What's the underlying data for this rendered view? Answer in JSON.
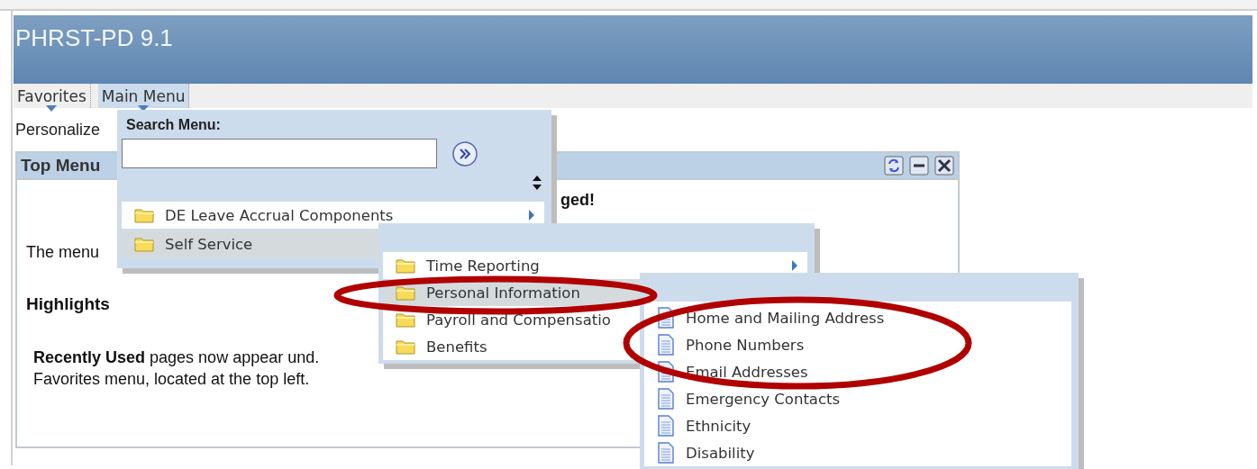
{
  "app_title": "PHRST-PD 9.1",
  "nav": [
    {
      "label": "Favorites",
      "selected": false
    },
    {
      "label": "Main Menu",
      "selected": true
    }
  ],
  "personalize": "Personalize",
  "portlet": {
    "title": "Top Menu",
    "notice_fragment": "ged!",
    "intro": "The menu",
    "heading": "Highlights",
    "paragraph_lines": [
      "**Recently Used** pages now appear und.",
      "Favorites menu, located at the top left."
    ]
  },
  "main_menu": {
    "search_label": "Search Menu:",
    "items": [
      {
        "label": "DE Leave Accrual Components",
        "selected": false,
        "arrow": true
      },
      {
        "label": "Self Service",
        "selected": true
      }
    ]
  },
  "submenu": {
    "items": [
      {
        "label": "Time Reporting",
        "selected": false,
        "arrow": true
      },
      {
        "label": "Personal Information",
        "selected": true
      },
      {
        "label": "Payroll and Compensatio",
        "selected": false
      },
      {
        "label": "Benefits",
        "selected": false
      }
    ]
  },
  "pages_menu": {
    "items": [
      {
        "label": "Home and Mailing Address"
      },
      {
        "label": "Phone Numbers"
      },
      {
        "label": "Email Addresses"
      },
      {
        "label": "Emergency Contacts"
      },
      {
        "label": "Ethnicity"
      },
      {
        "label": "Disability"
      }
    ]
  }
}
